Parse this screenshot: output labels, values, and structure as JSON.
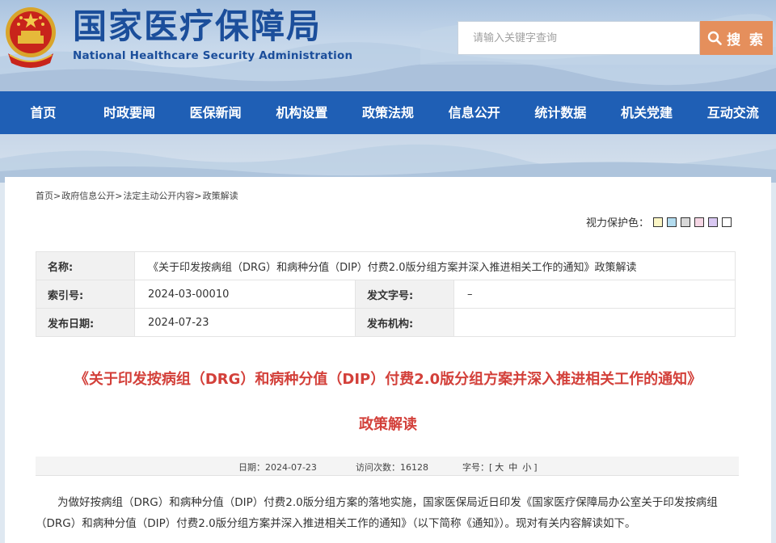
{
  "site": {
    "name_cn": "国家医疗保障局",
    "name_en": "National Healthcare Security Administration"
  },
  "search": {
    "placeholder": "请输入关键字查询",
    "button_label": "搜 索"
  },
  "nav": [
    "首页",
    "时政要闻",
    "医保新闻",
    "机构设置",
    "政策法规",
    "信息公开",
    "统计数据",
    "机关党建",
    "互动交流"
  ],
  "breadcrumb": [
    "首页>",
    "政府信息公开>",
    "法定主动公开内容>",
    "政策解读"
  ],
  "vision": {
    "label": "视力保护色：",
    "swatches": [
      "#fbf6c5",
      "#b3dcef",
      "#d8d8d8",
      "#f5d6e4",
      "#d9c8f2",
      "#ffffff"
    ]
  },
  "meta": {
    "name_label": "名称:",
    "name_value": "《关于印发按病组（DRG）和病种分值（DIP）付费2.0版分组方案并深入推进相关工作的通知》政策解读",
    "index_label": "索引号:",
    "index_value": "2024-03-00010",
    "doc_no_label": "发文字号:",
    "doc_no_value": "–",
    "date_label": "发布日期:",
    "date_value": "2024-07-23",
    "org_label": "发布机构:",
    "org_value": ""
  },
  "article": {
    "title": "《关于印发按病组（DRG）和病种分值（DIP）付费2.0版分组方案并深入推进相关工作的通知》",
    "subtitle": "政策解读",
    "date_label": "日期：",
    "date_value": "2024-07-23",
    "visits_label": "访问次数：",
    "visits_value": "16128",
    "fontsize_label": "字号：",
    "fontsize_open": "[",
    "fontsize_large": "大",
    "fontsize_medium": "中",
    "fontsize_small": "小",
    "fontsize_close": "]",
    "paragraph": "为做好按病组（DRG）和病种分值（DIP）付费2.0版分组方案的落地实施，国家医保局近日印发《国家医疗保障局办公室关于印发按病组（DRG）和病种分值（DIP）付费2.0版分组方案并深入推进相关工作的通知》（以下简称《通知》）。现对有关内容解读如下。"
  },
  "colors": {
    "brand_blue": "#1f5fb5",
    "title_red": "#d3403a",
    "search_orange": "#e58f5c"
  },
  "icons": {
    "emblem": "national-emblem-icon",
    "search": "magnifier-icon"
  }
}
